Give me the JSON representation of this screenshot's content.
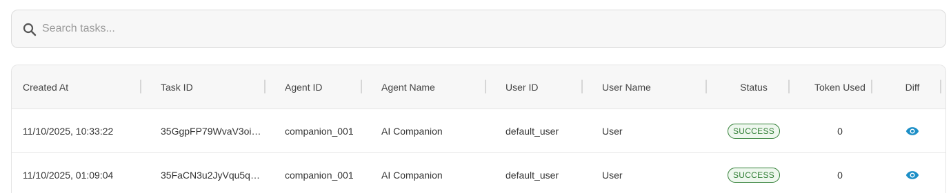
{
  "search": {
    "placeholder": "Search tasks..."
  },
  "table": {
    "headers": {
      "created_at": "Created At",
      "task_id": "Task ID",
      "agent_id": "Agent ID",
      "agent_name": "Agent Name",
      "user_id": "User ID",
      "user_name": "User Name",
      "status": "Status",
      "tokens": "Token Used",
      "diff": "Diff"
    },
    "rows": [
      {
        "created_at": "11/10/2025, 10:33:22",
        "task_id": "35GgpFP79WvaV3oiY...",
        "agent_id": "companion_001",
        "agent_name": "AI Companion",
        "user_id": "default_user",
        "user_name": "User",
        "status": "SUCCESS",
        "tokens": "0",
        "diff_icon": "eye-icon"
      },
      {
        "created_at": "11/10/2025, 01:09:04",
        "task_id": "35FaCN3u2JyVqu5qZ...",
        "agent_id": "companion_001",
        "agent_name": "AI Companion",
        "user_id": "default_user",
        "user_name": "User",
        "status": "SUCCESS",
        "tokens": "0",
        "diff_icon": "eye-icon"
      }
    ]
  },
  "colors": {
    "success": "#2e7d32",
    "success_bg": "#eef7ee",
    "accent": "#1d8fc7",
    "header_bg": "#f7f7f7"
  }
}
